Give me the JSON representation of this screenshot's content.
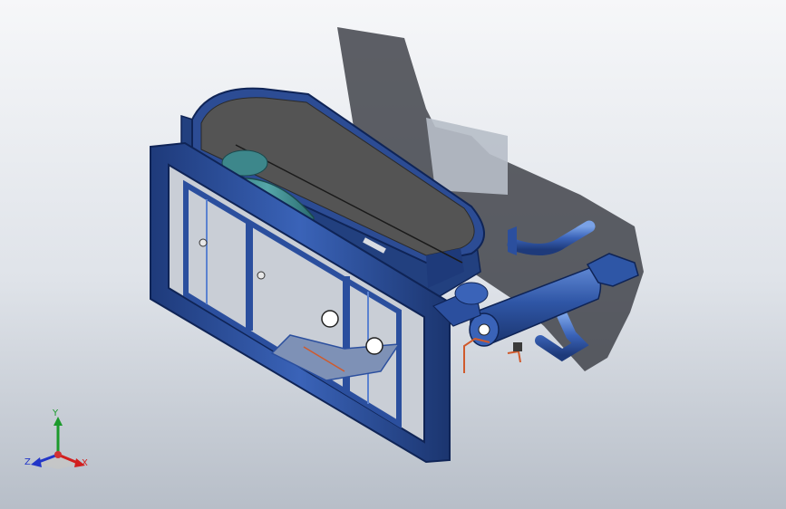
{
  "view": {
    "background_top": "#f6f7f9",
    "background_bottom": "#b7bec8",
    "model_color": "#2b4f9e",
    "belt_color": "#545454",
    "motor_color": "#3f8f93",
    "copper_color": "#d05a2c"
  },
  "model": {
    "parts": [
      "front-frame",
      "fan-belt-housing",
      "motor",
      "receiver-tank",
      "discharge-pipe",
      "copper-tubing",
      "shadow"
    ]
  },
  "triad": {
    "x_label": "X",
    "y_label": "Y",
    "z_label": "Z",
    "x_color": "#d21f1f",
    "y_color": "#1c9a2c",
    "z_color": "#2236c8"
  }
}
